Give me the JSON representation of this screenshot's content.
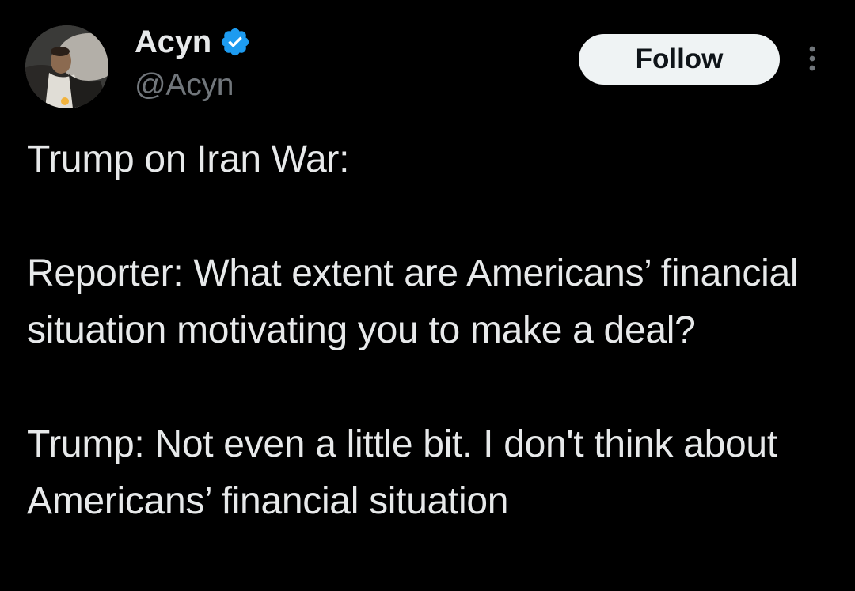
{
  "author": {
    "display_name": "Acyn",
    "handle": "@Acyn",
    "verified": true,
    "verified_color": "#1d9bf0"
  },
  "actions": {
    "follow_label": "Follow"
  },
  "tweet": {
    "paragraphs": [
      "Trump on Iran War:",
      "Reporter: What extent are Americans’ financial situation motivating you to make a deal?",
      "Trump: Not even a little bit. I don't think about Americans’ financial situation"
    ]
  },
  "icons": {
    "verified": "verified-badge-icon",
    "more": "more-options-icon"
  },
  "colors": {
    "background": "#000000",
    "text": "#e7e9ea",
    "secondary_text": "#71767b",
    "follow_button_bg": "#eff3f4",
    "follow_button_text": "#0f1419"
  }
}
